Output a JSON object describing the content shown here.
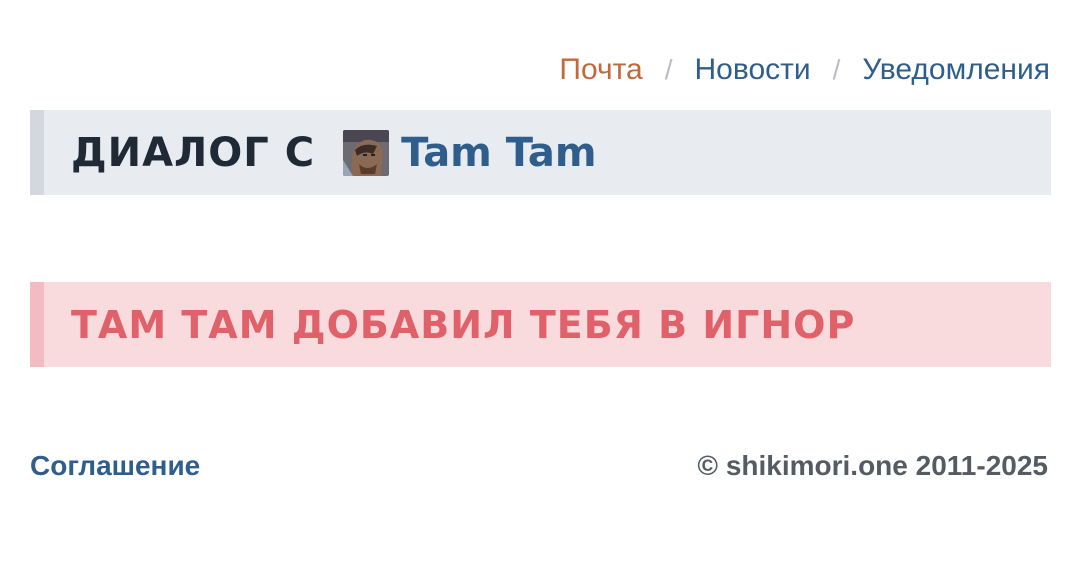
{
  "breadcrumbs": {
    "items": [
      {
        "label": "Почта",
        "state": "active"
      },
      {
        "label": "Новости",
        "state": "link"
      },
      {
        "label": "Уведомления",
        "state": "link"
      }
    ],
    "separator": "/"
  },
  "dialog": {
    "title": "ДИАЛОГ С",
    "user_name": "Tam Tam"
  },
  "notice": {
    "text": "ТАМ ТАМ ДОБАВИЛ ТЕБЯ В ИГНОР"
  },
  "footer": {
    "agreement_label": "Соглашение",
    "copyright": "© shikimori.one 2011-2025"
  },
  "colors": {
    "accent_active": "#c2693a",
    "link": "#2f5e8c",
    "notice_text": "#e0616a",
    "notice_bg": "#f9dadd",
    "header_bg": "#e8ebf0"
  }
}
